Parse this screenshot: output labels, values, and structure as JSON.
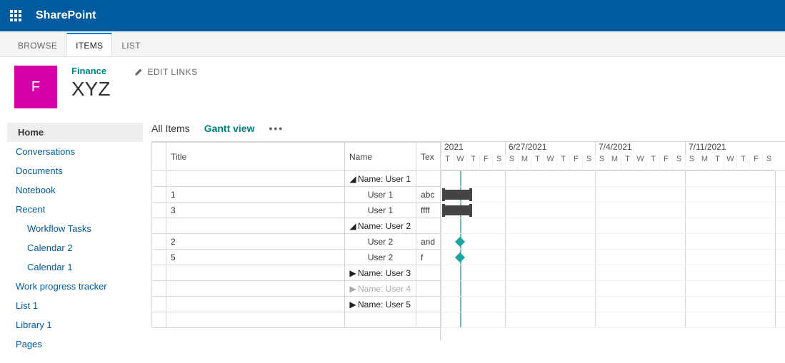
{
  "suite": {
    "brand": "SharePoint"
  },
  "ribbon": {
    "tabs": [
      "BROWSE",
      "ITEMS",
      "LIST"
    ],
    "active": 1
  },
  "header": {
    "site_logo_letter": "F",
    "site_link": "Finance",
    "list_title": "XYZ",
    "edit_links_label": "EDIT LINKS"
  },
  "leftnav": {
    "items": [
      {
        "label": "Home",
        "selected": true
      },
      {
        "label": "Conversations"
      },
      {
        "label": "Documents"
      },
      {
        "label": "Notebook"
      },
      {
        "label": "Recent"
      },
      {
        "label": "Workflow Tasks",
        "sub": true
      },
      {
        "label": "Calendar 2",
        "sub": true
      },
      {
        "label": "Calendar 1",
        "sub": true
      },
      {
        "label": "Work progress tracker"
      },
      {
        "label": "List 1"
      },
      {
        "label": "Library 1"
      },
      {
        "label": "Pages"
      }
    ]
  },
  "viewbar": {
    "views": [
      "All Items",
      "Gantt view"
    ],
    "active": 1
  },
  "grid": {
    "columns": {
      "title": "Title",
      "name": "Name",
      "text": "Tex"
    },
    "rows": [
      {
        "type": "group",
        "expanded": true,
        "name": "Name: User 1"
      },
      {
        "type": "item",
        "title": "1",
        "name": "User 1",
        "text": "abc"
      },
      {
        "type": "item",
        "title": "3",
        "name": "User 1",
        "text": "ffff"
      },
      {
        "type": "group",
        "expanded": true,
        "name": "Name: User 2"
      },
      {
        "type": "item",
        "title": "2",
        "name": "User 2",
        "text": "and"
      },
      {
        "type": "item",
        "title": "5",
        "name": "User 2",
        "text": "f"
      },
      {
        "type": "group",
        "expanded": false,
        "name": "Name: User 3"
      },
      {
        "type": "group",
        "expanded": false,
        "name": "Name: User 4",
        "dim": true
      },
      {
        "type": "group",
        "expanded": false,
        "name": "Name: User 5"
      }
    ]
  },
  "timeline": {
    "partial_label": "2021",
    "weeks": [
      "6/27/2021",
      "7/4/2021",
      "7/11/2021"
    ],
    "leading_days": [
      "T",
      "W",
      "T",
      "F",
      "S"
    ],
    "week_days": [
      "S",
      "M",
      "T",
      "W",
      "T",
      "F",
      "S"
    ],
    "day_width": 18,
    "today_col": 1,
    "events": [
      {
        "row": 1,
        "kind": "bar",
        "start": 0,
        "end": 2
      },
      {
        "row": 2,
        "kind": "bar",
        "start": 0,
        "end": 2
      },
      {
        "row": 4,
        "kind": "ms",
        "at": 1
      },
      {
        "row": 5,
        "kind": "ms",
        "at": 1
      }
    ]
  }
}
